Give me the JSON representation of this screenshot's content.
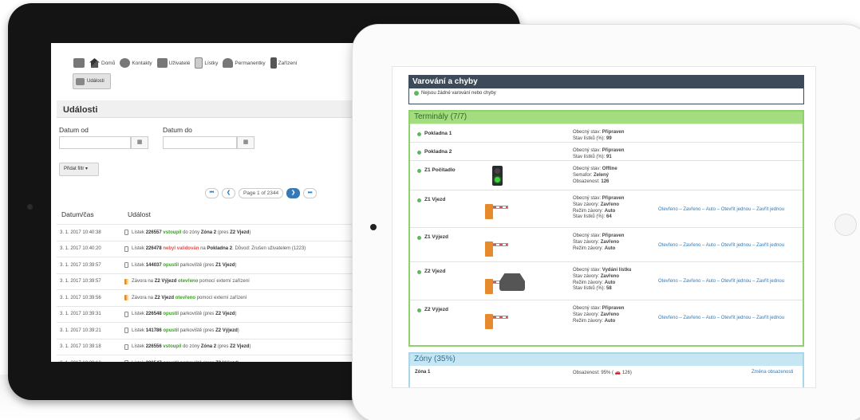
{
  "left_screen": {
    "nav": [
      {
        "icon": "home-icon",
        "label": "Domů"
      },
      {
        "icon": "contacts-icon",
        "label": "Kontakty"
      },
      {
        "icon": "users-icon",
        "label": "Uživatelé"
      },
      {
        "icon": "tickets-icon",
        "label": "Lístky"
      },
      {
        "icon": "car-icon",
        "label": "Permanentky"
      },
      {
        "icon": "barrier-icon",
        "label": "Zařízení"
      }
    ],
    "events_button": "Události",
    "title": "Události",
    "date_from_label": "Datum od",
    "date_to_label": "Datum do",
    "filter_button": "Přidat filtr ▾",
    "pager": {
      "first": "⏮",
      "prev": "❮",
      "text": "Page 1 of 2344",
      "next": "❯",
      "last": "⏭"
    },
    "col_time": "Datum/čas",
    "col_event": "Událost",
    "rows": [
      {
        "time": "3. 1. 2017 10:40:38",
        "icon": "ticket",
        "parts": [
          [
            "",
            "Lístek "
          ],
          [
            "b",
            "226557 "
          ],
          [
            "g",
            "vstoupil"
          ],
          [
            "",
            " do zóny "
          ],
          [
            "b",
            "Zóna 2"
          ],
          [
            "",
            " (pres "
          ],
          [
            "b",
            "Z2 Vjezd"
          ],
          [
            "",
            ")"
          ]
        ]
      },
      {
        "time": "3. 1. 2017 10:40:20",
        "icon": "ticket",
        "parts": [
          [
            "",
            "Lístek "
          ],
          [
            "b",
            "226478 "
          ],
          [
            "r",
            "nebyl validován"
          ],
          [
            "",
            " na "
          ],
          [
            "b",
            "Pokladna 2"
          ],
          [
            "",
            ". Důvod: Zrušen uživatelem (1223)"
          ]
        ]
      },
      {
        "time": "3. 1. 2017 10:39:57",
        "icon": "ticket",
        "parts": [
          [
            "",
            "Lístek "
          ],
          [
            "b",
            "144037 "
          ],
          [
            "g",
            "opustil"
          ],
          [
            "",
            " parkoviště (pres "
          ],
          [
            "b",
            "Z1 Vjezd"
          ],
          [
            "",
            ")"
          ]
        ]
      },
      {
        "time": "3. 1. 2017 10:39:57",
        "icon": "barrier",
        "parts": [
          [
            "",
            "Závora na "
          ],
          [
            "b",
            "Z2 Výjezd "
          ],
          [
            "g",
            "otevřeno"
          ],
          [
            "",
            " pomocí externí zařízení"
          ]
        ]
      },
      {
        "time": "3. 1. 2017 10:39:56",
        "icon": "barrier",
        "parts": [
          [
            "",
            "Závora na "
          ],
          [
            "b",
            "Z2 Vjezd "
          ],
          [
            "g",
            "otevřeno"
          ],
          [
            "",
            " pomocí externí zařízení"
          ]
        ]
      },
      {
        "time": "3. 1. 2017 10:39:31",
        "icon": "ticket",
        "parts": [
          [
            "",
            "Lístek "
          ],
          [
            "b",
            "226548 "
          ],
          [
            "g",
            "opustil"
          ],
          [
            "",
            " parkoviště (pres "
          ],
          [
            "b",
            "Z2 Vjezd"
          ],
          [
            "",
            ")"
          ]
        ]
      },
      {
        "time": "3. 1. 2017 10:39:21",
        "icon": "ticket",
        "parts": [
          [
            "",
            "Lístek "
          ],
          [
            "b",
            "141786 "
          ],
          [
            "g",
            "opustil"
          ],
          [
            "",
            " parkoviště (pres "
          ],
          [
            "b",
            "Z2 Výjezd"
          ],
          [
            "",
            ")"
          ]
        ]
      },
      {
        "time": "3. 1. 2017 10:39:18",
        "icon": "ticket",
        "parts": [
          [
            "",
            "Lístek "
          ],
          [
            "b",
            "226556 "
          ],
          [
            "g",
            "vstoupil"
          ],
          [
            "",
            " do zóny "
          ],
          [
            "b",
            "Zóna 2"
          ],
          [
            "",
            " (pres "
          ],
          [
            "b",
            "Z2 Vjezd"
          ],
          [
            "",
            ")"
          ]
        ]
      },
      {
        "time": "3. 1. 2017 10:39:12",
        "icon": "ticket",
        "parts": [
          [
            "",
            "Lístek "
          ],
          [
            "b",
            "226547 "
          ],
          [
            "g",
            "opustil"
          ],
          [
            "",
            " parkoviště (pres "
          ],
          [
            "b",
            "Z2 Výjezd"
          ],
          [
            "",
            ")"
          ]
        ]
      }
    ]
  },
  "right_screen": {
    "warnings_title": "Varování a chyby",
    "warnings_ok": "Nejsou žádné varování nebo chyby",
    "terminals_title": "Terminály (7/7)",
    "action_links": "Otevřeno – Zavřeno – Auto – Otevřít jednou – Zavřít jednou",
    "terminals": [
      {
        "name": "Pokladna 1",
        "lines": [
          [
            "Obecný stav: ",
            "Připraven"
          ],
          [
            "Stav lístků (%): ",
            "99"
          ]
        ],
        "icon": "",
        "actions": false
      },
      {
        "name": "Pokladna 2",
        "lines": [
          [
            "Obecný stav: ",
            "Připraven"
          ],
          [
            "Stav lístků (%): ",
            "91"
          ]
        ],
        "icon": "",
        "actions": false
      },
      {
        "name": "Z1 Počítadlo",
        "lines": [
          [
            "Obecný stav: ",
            "Offline"
          ],
          [
            "Semafor: ",
            "Zelený"
          ],
          [
            "Obsazenost: ",
            "126"
          ]
        ],
        "icon": "traffic-light",
        "actions": false
      },
      {
        "name": "Z1 Vjezd",
        "lines": [
          [
            "Obecný stav: ",
            "Připraven"
          ],
          [
            "Stav závory: ",
            "Zavřeno"
          ],
          [
            "Režim závory: ",
            "Auto"
          ],
          [
            "Stav lístků (%): ",
            "64"
          ]
        ],
        "icon": "barrier",
        "actions": true
      },
      {
        "name": "Z1 Výjezd",
        "lines": [
          [
            "Obecný stav: ",
            "Připraven"
          ],
          [
            "Stav závory: ",
            "Zavřeno"
          ],
          [
            "Režim závory: ",
            "Auto"
          ]
        ],
        "icon": "barrier",
        "actions": true
      },
      {
        "name": "Z2 Vjezd",
        "lines": [
          [
            "Obecný stav: ",
            "Vydání lístku"
          ],
          [
            "Stav závory: ",
            "Zavřeno"
          ],
          [
            "Režim závory: ",
            "Auto"
          ],
          [
            "Stav lístků (%): ",
            "58"
          ]
        ],
        "icon": "barrier-car",
        "actions": true
      },
      {
        "name": "Z2 Výjezd",
        "lines": [
          [
            "Obecný stav: ",
            "Připraven"
          ],
          [
            "Stav závory: ",
            "Zavřeno"
          ],
          [
            "Režim závory: ",
            "Auto"
          ]
        ],
        "icon": "barrier",
        "actions": true
      }
    ],
    "zones_title": "Zóny (35%)",
    "zone_name": "Zóna 1",
    "zone_occupancy": "Obsazenost: 95% ( 🚗 126)",
    "zone_link": "Změna obsazenosti"
  }
}
